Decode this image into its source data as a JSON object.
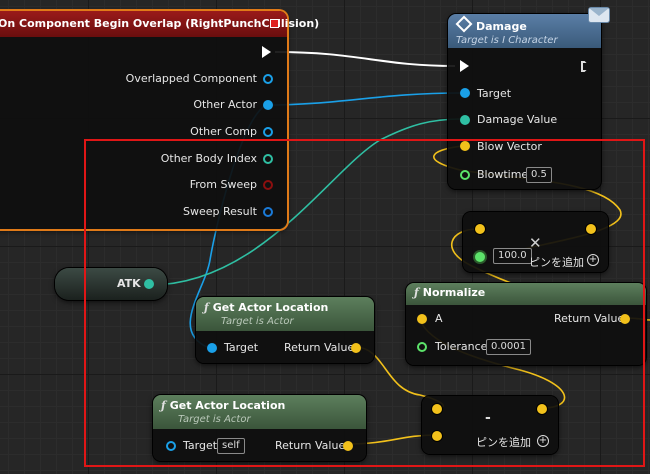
{
  "event_node": {
    "title": "On Component Begin Overlap (RightPunchCollision)",
    "pins": [
      "Overlapped Component",
      "Other Actor",
      "Other Comp",
      "Other Body Index",
      "From Sweep",
      "Sweep Result"
    ]
  },
  "damage_node": {
    "title": "Damage",
    "subtitle": "Target is I Character",
    "pins": {
      "target": "Target",
      "damage_value": "Damage Value",
      "blow_vector": "Blow Vector",
      "blowtime": "Blowtime"
    },
    "blowtime_value": "0.5"
  },
  "multiply_node": {
    "value": "100.0",
    "add_pin_label": "ピンを追加"
  },
  "atk_node": {
    "label": "ATK"
  },
  "get_actor_location_1": {
    "title": "Get Actor Location",
    "subtitle": "Target is Actor",
    "target_label": "Target",
    "return_label": "Return Value"
  },
  "get_actor_location_2": {
    "title": "Get Actor Location",
    "subtitle": "Target is Actor",
    "target_label": "Target",
    "target_value": "self",
    "return_label": "Return Value"
  },
  "normalize_node": {
    "title": "Normalize",
    "a_label": "A",
    "return_label": "Return Value",
    "tolerance_label": "Tolerance",
    "tolerance_value": "0.0001"
  },
  "subtract_node": {
    "symbol": "-",
    "add_pin_label": "ピンを追加"
  },
  "colors": {
    "exec": "#ffffff",
    "object_pin": "#1aa0e8",
    "float_pin": "#5ce36a",
    "struct_pin": "#2fbfa3",
    "vector_pin": "#f2c11b",
    "bool_pin": "#8c0f0f",
    "event_header": "#8a1515",
    "event_border": "#e07a18",
    "damage_header": "#4d6f93",
    "func_header": "#4f6b4f",
    "selection": "#e01616"
  },
  "icons": [
    "message-icon",
    "interface-call-icon",
    "function-icon",
    "close-icon",
    "add-pin-icon",
    "event-delegate-icon"
  ]
}
